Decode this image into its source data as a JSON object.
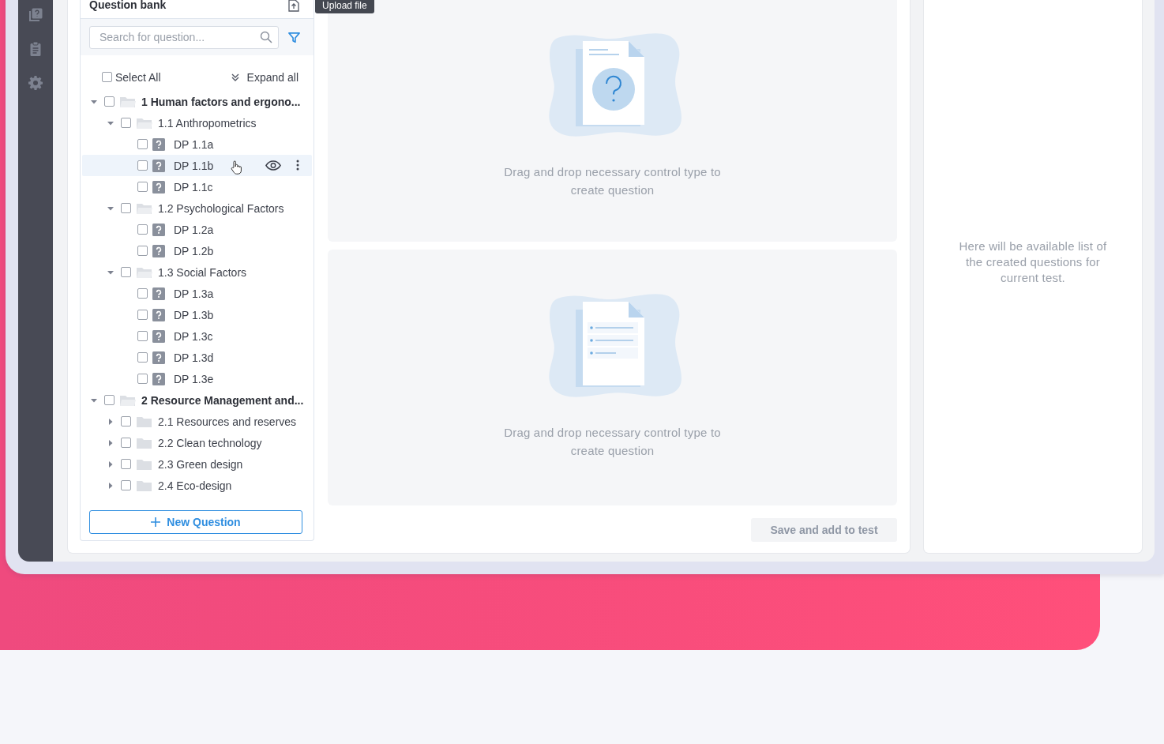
{
  "question_bank": {
    "title": "Question bank",
    "upload_tooltip": "Upload file",
    "search": {
      "placeholder": "Search for question..."
    },
    "select_all": {
      "label": "Select All",
      "checked": false
    },
    "expand_all": "Expand all",
    "tree": [
      {
        "kind": "folder",
        "label": "1 Human factors and ergono...",
        "checked": false,
        "expanded": true,
        "children": [
          {
            "kind": "folder",
            "label": "1.1 Anthropometrics",
            "checked": false,
            "expanded": true,
            "children": [
              {
                "kind": "question",
                "label": "DP 1.1a",
                "checked": false,
                "highlighted": false
              },
              {
                "kind": "question",
                "label": "DP 1.1b",
                "checked": false,
                "highlighted": true
              },
              {
                "kind": "question",
                "label": "DP 1.1c",
                "checked": false,
                "highlighted": false
              }
            ]
          },
          {
            "kind": "folder",
            "label": "1.2 Psychological Factors",
            "checked": false,
            "expanded": true,
            "children": [
              {
                "kind": "question",
                "label": "DP 1.2a",
                "checked": false,
                "highlighted": false
              },
              {
                "kind": "question",
                "label": "DP 1.2b",
                "checked": false,
                "highlighted": false
              }
            ]
          },
          {
            "kind": "folder",
            "label": "1.3 Social Factors",
            "checked": false,
            "expanded": true,
            "children": [
              {
                "kind": "question",
                "label": "DP 1.3a",
                "checked": false,
                "highlighted": false
              },
              {
                "kind": "question",
                "label": "DP 1.3b",
                "checked": false,
                "highlighted": false
              },
              {
                "kind": "question",
                "label": "DP 1.3c",
                "checked": false,
                "highlighted": false
              },
              {
                "kind": "question",
                "label": "DP 1.3d",
                "checked": false,
                "highlighted": false
              },
              {
                "kind": "question",
                "label": "DP 1.3e",
                "checked": false,
                "highlighted": false
              }
            ]
          }
        ]
      },
      {
        "kind": "folder",
        "label": "2 Resource Management and...",
        "checked": false,
        "expanded": true,
        "children": [
          {
            "kind": "folder",
            "label": "2.1 Resources and reserves",
            "checked": false,
            "expanded": false
          },
          {
            "kind": "folder",
            "label": "2.2 Clean technology",
            "checked": false,
            "expanded": false
          },
          {
            "kind": "folder",
            "label": "2.3 Green design",
            "checked": false,
            "expanded": false
          },
          {
            "kind": "folder",
            "label": "2.4 Eco-design",
            "checked": false,
            "expanded": false
          }
        ]
      }
    ],
    "new_question_button": "New Question"
  },
  "drop_zones": [
    {
      "kind": "question",
      "hint": "Drag and drop necessary control type to create question"
    },
    {
      "kind": "list",
      "hint": "Drag and drop necessary control type to create question"
    }
  ],
  "save_button": {
    "label": "Save and add to test",
    "disabled": true
  },
  "questions_panel": {
    "hint": "Here will be available list of the created questions for current test."
  }
}
